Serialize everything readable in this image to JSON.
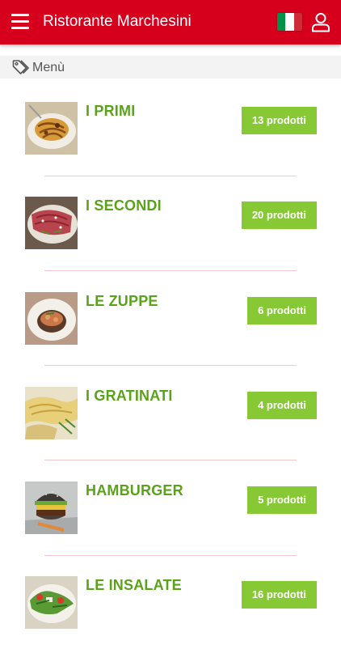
{
  "header": {
    "title": "Ristorante Marchesini",
    "menu_icon": "hamburger-icon",
    "language_icon": "flag-italy-icon",
    "account_icon": "user-icon",
    "colors": {
      "bar": "#d6001c",
      "flag_green": "#009246",
      "flag_white": "#ffffff",
      "flag_red": "#ce2b37"
    }
  },
  "section": {
    "icon": "tag-icon",
    "title": "Menù"
  },
  "colors": {
    "category_text": "#5aa21a",
    "badge": "#87c935",
    "divider": "#f2c7cc"
  },
  "categories": [
    {
      "name": "I PRIMI",
      "count_label": "13 prodotti"
    },
    {
      "name": "I SECONDI",
      "count_label": "20 prodotti"
    },
    {
      "name": "LE ZUPPE",
      "count_label": "6 prodotti"
    },
    {
      "name": "I GRATINATI",
      "count_label": "4 prodotti"
    },
    {
      "name": "HAMBURGER",
      "count_label": "5 prodotti"
    },
    {
      "name": "LE INSALATE",
      "count_label": "16 prodotti"
    }
  ]
}
